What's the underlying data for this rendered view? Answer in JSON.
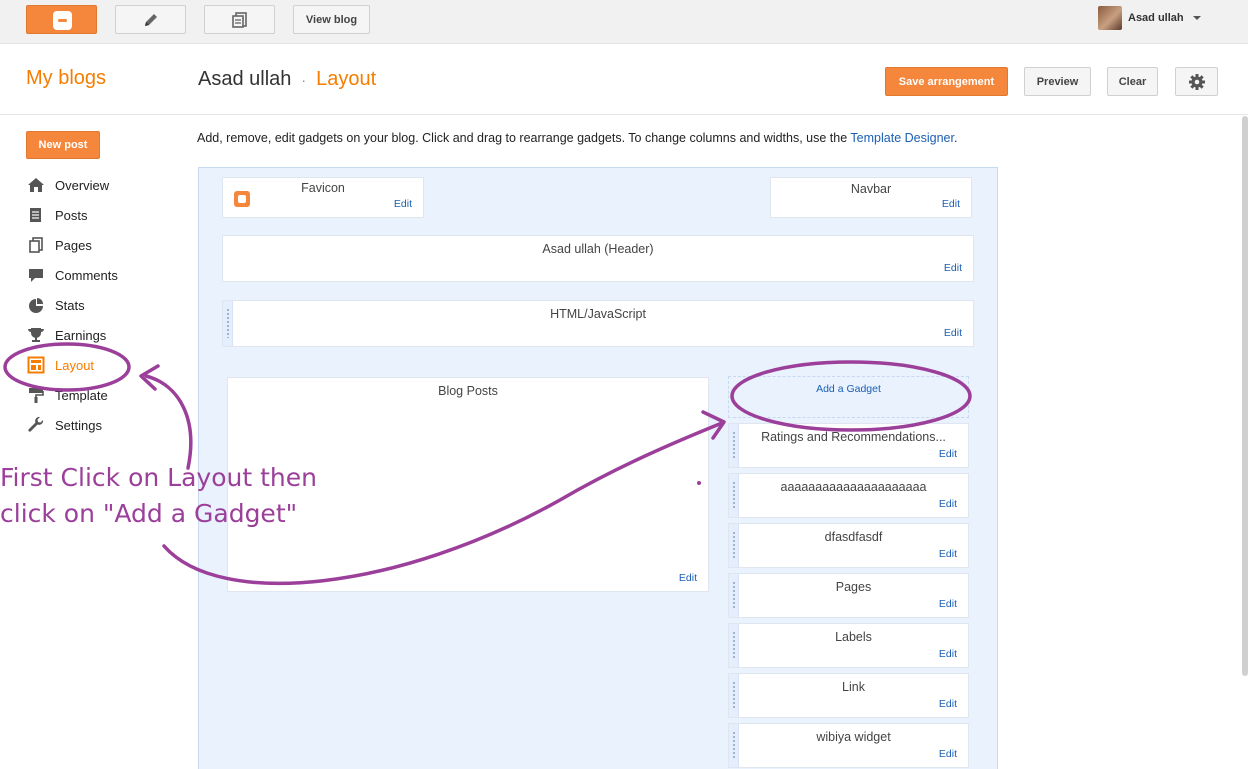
{
  "topbar": {
    "view_blog_label": "View blog",
    "user_name": "Asad ullah",
    "icons": [
      "blogger-logo-icon",
      "pencil-icon",
      "posts-list-icon",
      "avatar",
      "chevron-down-icon"
    ]
  },
  "header": {
    "my_blogs": "My blogs",
    "blog_name": "Asad ullah",
    "separator": "·",
    "current_page": "Layout",
    "save_label": "Save arrangement",
    "preview_label": "Preview",
    "clear_label": "Clear",
    "settings_icon": "gear-icon"
  },
  "sidebar": {
    "new_post_label": "New post",
    "items": [
      {
        "label": "Overview",
        "icon": "home-icon"
      },
      {
        "label": "Posts",
        "icon": "posts-icon"
      },
      {
        "label": "Pages",
        "icon": "pages-icon"
      },
      {
        "label": "Comments",
        "icon": "comment-icon"
      },
      {
        "label": "Stats",
        "icon": "pie-chart-icon"
      },
      {
        "label": "Earnings",
        "icon": "trophy-icon"
      },
      {
        "label": "Layout",
        "icon": "layout-icon",
        "active": true
      },
      {
        "label": "Template",
        "icon": "paint-roller-icon"
      },
      {
        "label": "Settings",
        "icon": "wrench-icon"
      }
    ]
  },
  "description": {
    "text": "Add, remove, edit gadgets on your blog. Click and drag to rearrange gadgets. To change columns and widths, use the ",
    "link": "Template Designer",
    "end": "."
  },
  "layout": {
    "edit_label": "Edit",
    "favicon": "Favicon",
    "navbar": "Navbar",
    "header": "Asad ullah (Header)",
    "html_js": "HTML/JavaScript",
    "blog_posts": "Blog Posts",
    "add_gadget": "Add a Gadget",
    "sidebar_gadgets": [
      "Ratings and Recommendations...",
      "aaaaaaaaaaaaaaaaaaaaa",
      "dfasdfasdf",
      "Pages",
      "Labels",
      "Link",
      "wibiya widget"
    ]
  },
  "annotation": {
    "line1": "First Click on Layout then",
    "line2": "click on \"Add a Gadget\"",
    "color": "#9b3f9a"
  },
  "colors": {
    "accent": "#f57d00",
    "button_orange": "#f4873c",
    "link": "#1a5fb4",
    "canvas_bg": "#eaf2fd"
  }
}
